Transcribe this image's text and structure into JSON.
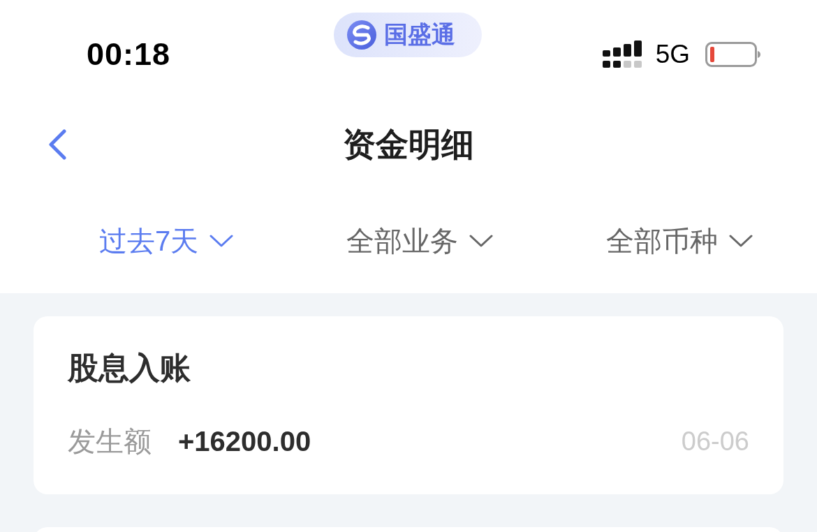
{
  "status_bar": {
    "time": "00:18",
    "network": "5G"
  },
  "logo": {
    "text": "国盛通"
  },
  "header": {
    "title": "资金明细"
  },
  "filters": [
    {
      "label": "过去7天",
      "selected": true
    },
    {
      "label": "全部业务",
      "selected": false
    },
    {
      "label": "全部币种",
      "selected": false
    }
  ],
  "records": [
    {
      "title": "股息入账",
      "amount_label": "发生额",
      "amount": "+16200.00",
      "date": "06-06"
    }
  ]
}
